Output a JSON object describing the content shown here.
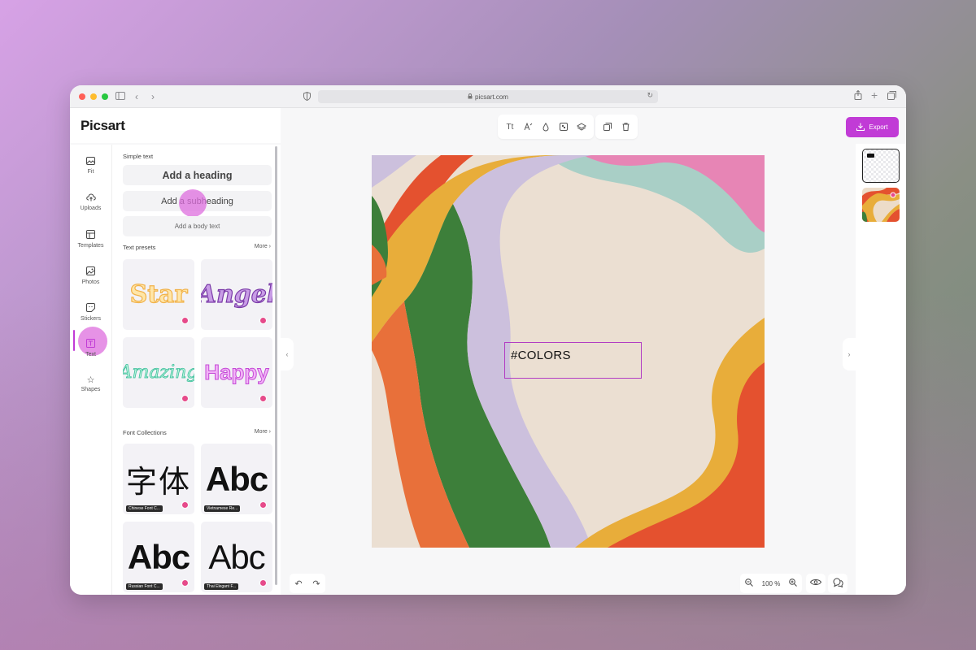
{
  "browser": {
    "url": "picsart.com",
    "icons": [
      "sidebar-icon",
      "back-icon",
      "forward-icon",
      "shield-icon",
      "lock-icon",
      "reload-icon",
      "share-icon",
      "new-tab-icon",
      "tabs-icon"
    ]
  },
  "app": {
    "logo": "Picsart",
    "export_label": "Export",
    "accent": "#c13bd6"
  },
  "rail": {
    "items": [
      {
        "label": "Fit",
        "icon": "image-icon"
      },
      {
        "label": "Uploads",
        "icon": "upload-icon"
      },
      {
        "label": "Templates",
        "icon": "template-icon"
      },
      {
        "label": "Photos",
        "icon": "photo-icon"
      },
      {
        "label": "Stickers",
        "icon": "sticker-icon"
      },
      {
        "label": "Text",
        "icon": "text-icon"
      },
      {
        "label": "Shapes",
        "icon": "star-icon"
      }
    ],
    "active": "Text"
  },
  "panel": {
    "simple_text_title": "Simple text",
    "heading": "Add a heading",
    "subheading": "Add a subheading",
    "body": "Add a body text",
    "presets_title": "Text presets",
    "presets_more": "More",
    "presets": [
      "Star",
      "Angel",
      "Amazing",
      "Happy"
    ],
    "fonts_title": "Font Collections",
    "fonts_more": "More",
    "fonts": [
      {
        "preview": "字体",
        "label": "Chinese Font C..."
      },
      {
        "preview": "Abc",
        "label": "Vietnamese Re..."
      },
      {
        "preview": "Abc",
        "label": "Russian Font C..."
      },
      {
        "preview": "Abc",
        "label": "Thai Elegant F..."
      }
    ]
  },
  "toolbar": {
    "text_tool": "Tt",
    "icons": [
      "font-style-icon",
      "color-drop-icon",
      "transparency-icon",
      "layers-icon",
      "duplicate-icon",
      "delete-icon"
    ]
  },
  "canvas": {
    "text": "#COLORS",
    "background": "#ebdfd2"
  },
  "zoom": {
    "level": "100 %"
  }
}
